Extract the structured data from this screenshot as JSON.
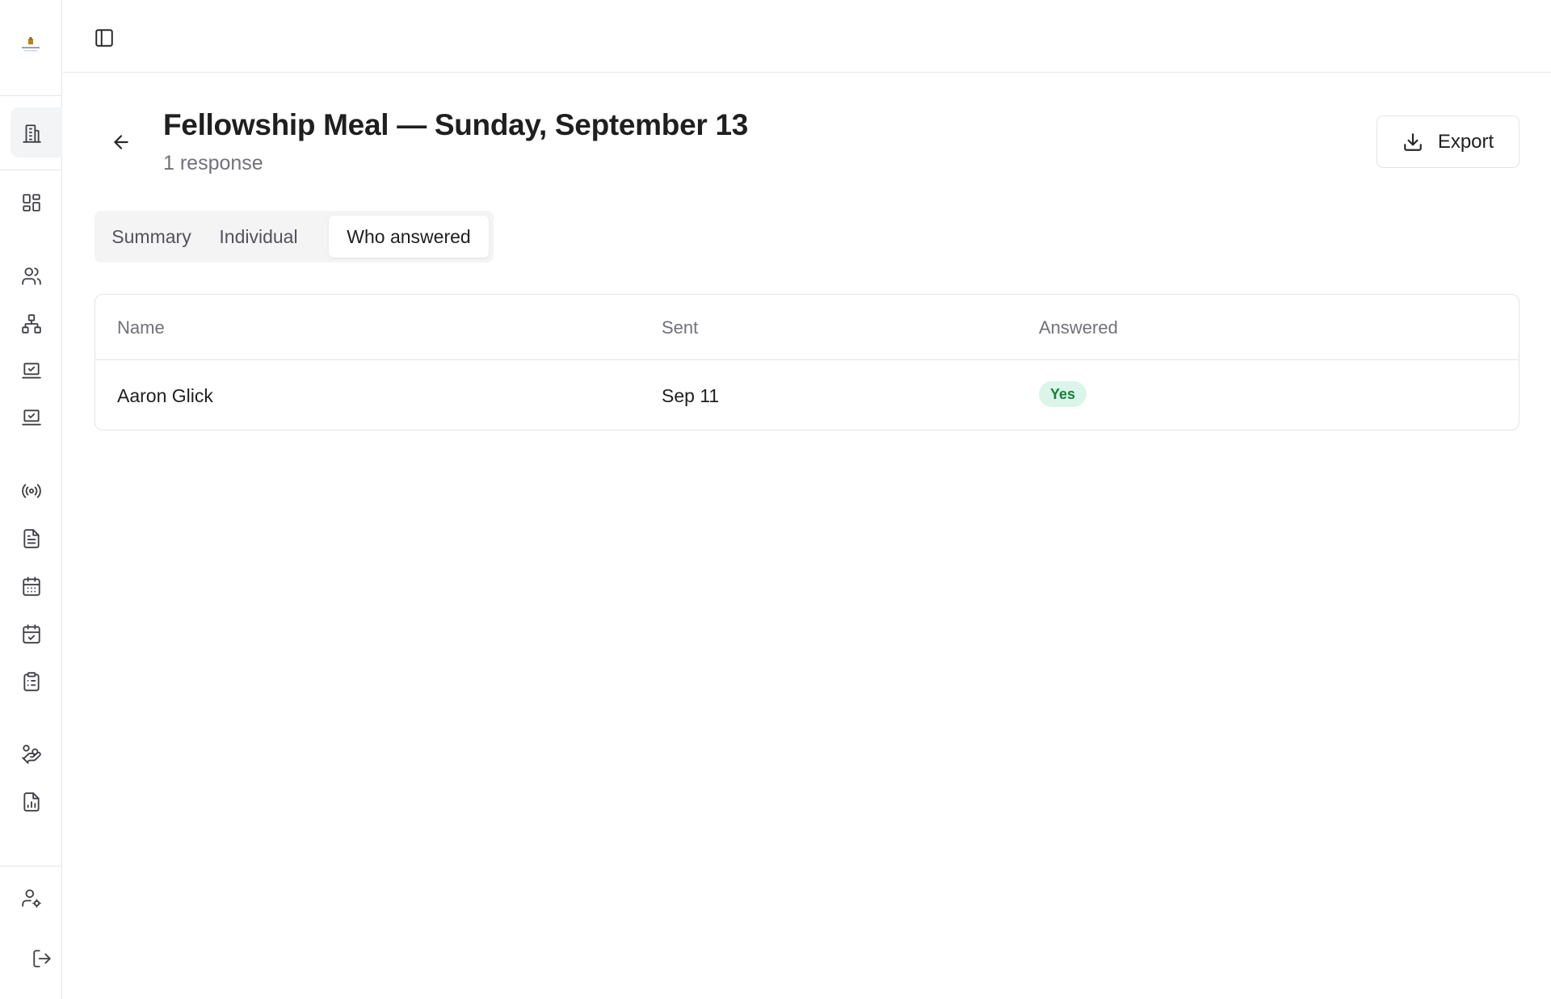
{
  "sidebar": {
    "logo_name": "church-logo",
    "icons": [
      "building-icon",
      "dashboard-grid-icon",
      "users-icon",
      "org-chart-icon",
      "laptop-check-icon",
      "laptop-check-icon",
      "broadcast-icon",
      "document-icon",
      "calendar-icon",
      "calendar-check-icon",
      "clipboard-list-icon",
      "hand-coins-icon",
      "file-chart-icon",
      "user-settings-icon",
      "logout-icon"
    ]
  },
  "page": {
    "title": "Fellowship Meal — Sunday, September 13",
    "subtitle": "1 response",
    "export_label": "Export"
  },
  "tabs": {
    "items": [
      "Summary",
      "Individual",
      "Who answered"
    ],
    "active": "Who answered"
  },
  "table": {
    "headers": [
      "Name",
      "Sent",
      "Answered"
    ],
    "rows": [
      {
        "name": "Aaron Glick",
        "sent": "Sep 11",
        "answered": "Yes"
      }
    ]
  },
  "colors": {
    "badge_bg": "#dcf5ea",
    "badge_text": "#15803d",
    "border": "#e4e4e7"
  }
}
